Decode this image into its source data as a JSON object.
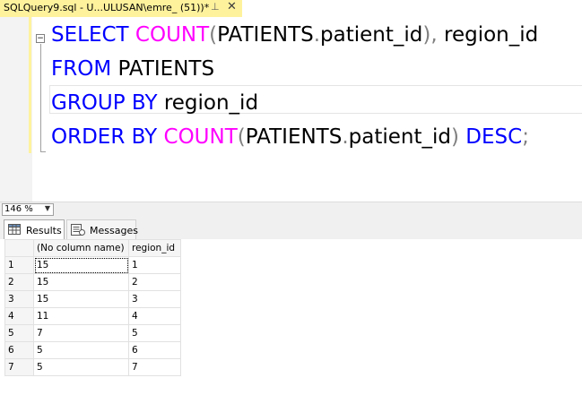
{
  "tab": {
    "title": "SQLQuery9.sql - U...ULUSAN\\emre_ (51))*",
    "pin_icon": "pin-icon",
    "close_icon": "close-icon"
  },
  "editor": {
    "lines": [
      {
        "parts": [
          [
            "kw",
            "SELECT "
          ],
          [
            "fn",
            "COUNT"
          ],
          [
            "op",
            "("
          ],
          [
            "id",
            "PATIENTS"
          ],
          [
            "op",
            "."
          ],
          [
            "id",
            "patient_id"
          ],
          [
            "op",
            "), "
          ],
          [
            "id",
            "region_id"
          ]
        ]
      },
      {
        "parts": [
          [
            "kw",
            "FROM "
          ],
          [
            "id",
            "PATIENTS"
          ]
        ]
      },
      {
        "parts": [
          [
            "kw",
            "GROUP BY "
          ],
          [
            "id",
            "region_id"
          ]
        ]
      },
      {
        "parts": [
          [
            "kw",
            "ORDER BY "
          ],
          [
            "fn",
            "COUNT"
          ],
          [
            "op",
            "("
          ],
          [
            "id",
            "PATIENTS"
          ],
          [
            "op",
            "."
          ],
          [
            "id",
            "patient_id"
          ],
          [
            "op",
            ") "
          ],
          [
            "kw",
            "DESC"
          ],
          [
            "op",
            ";"
          ]
        ]
      }
    ]
  },
  "zoom": {
    "value": "146 %"
  },
  "results_tabs": [
    {
      "label": "Results",
      "icon": "grid-icon",
      "active": true
    },
    {
      "label": "Messages",
      "icon": "messages-icon",
      "active": false
    }
  ],
  "grid": {
    "columns": [
      "(No column name)",
      "region_id"
    ],
    "rows": [
      [
        "1",
        "15",
        "1"
      ],
      [
        "2",
        "15",
        "2"
      ],
      [
        "3",
        "15",
        "3"
      ],
      [
        "4",
        "11",
        "4"
      ],
      [
        "5",
        "7",
        "5"
      ],
      [
        "6",
        "5",
        "6"
      ],
      [
        "7",
        "5",
        "7"
      ]
    ]
  }
}
